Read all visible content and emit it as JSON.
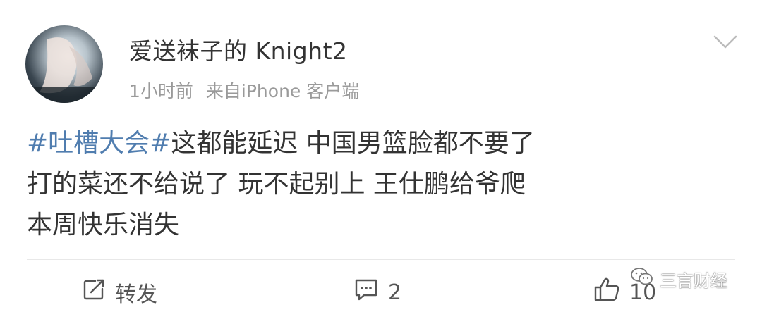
{
  "user": {
    "name": "爱送袜子的 Knight2",
    "time": "1小时前",
    "source": "来自iPhone 客户端"
  },
  "post": {
    "hashtag": "#吐槽大会#",
    "line1_rest": "这都能延迟 中国男篮脸都不要了",
    "line2": "打的菜还不给说了 玩不起别上 王仕鹏给爷爬",
    "line3": "本周快乐消失"
  },
  "actions": {
    "repost_label": "转发",
    "comment_count": "2",
    "like_count": "10"
  },
  "watermark": {
    "text": "三言财经"
  },
  "colors": {
    "hashtag": "#507daf",
    "text": "#333333",
    "meta": "#9a9a9a"
  },
  "icons": [
    "chevron-down-icon",
    "repost-icon",
    "comment-icon",
    "like-icon",
    "wechat-icon"
  ]
}
